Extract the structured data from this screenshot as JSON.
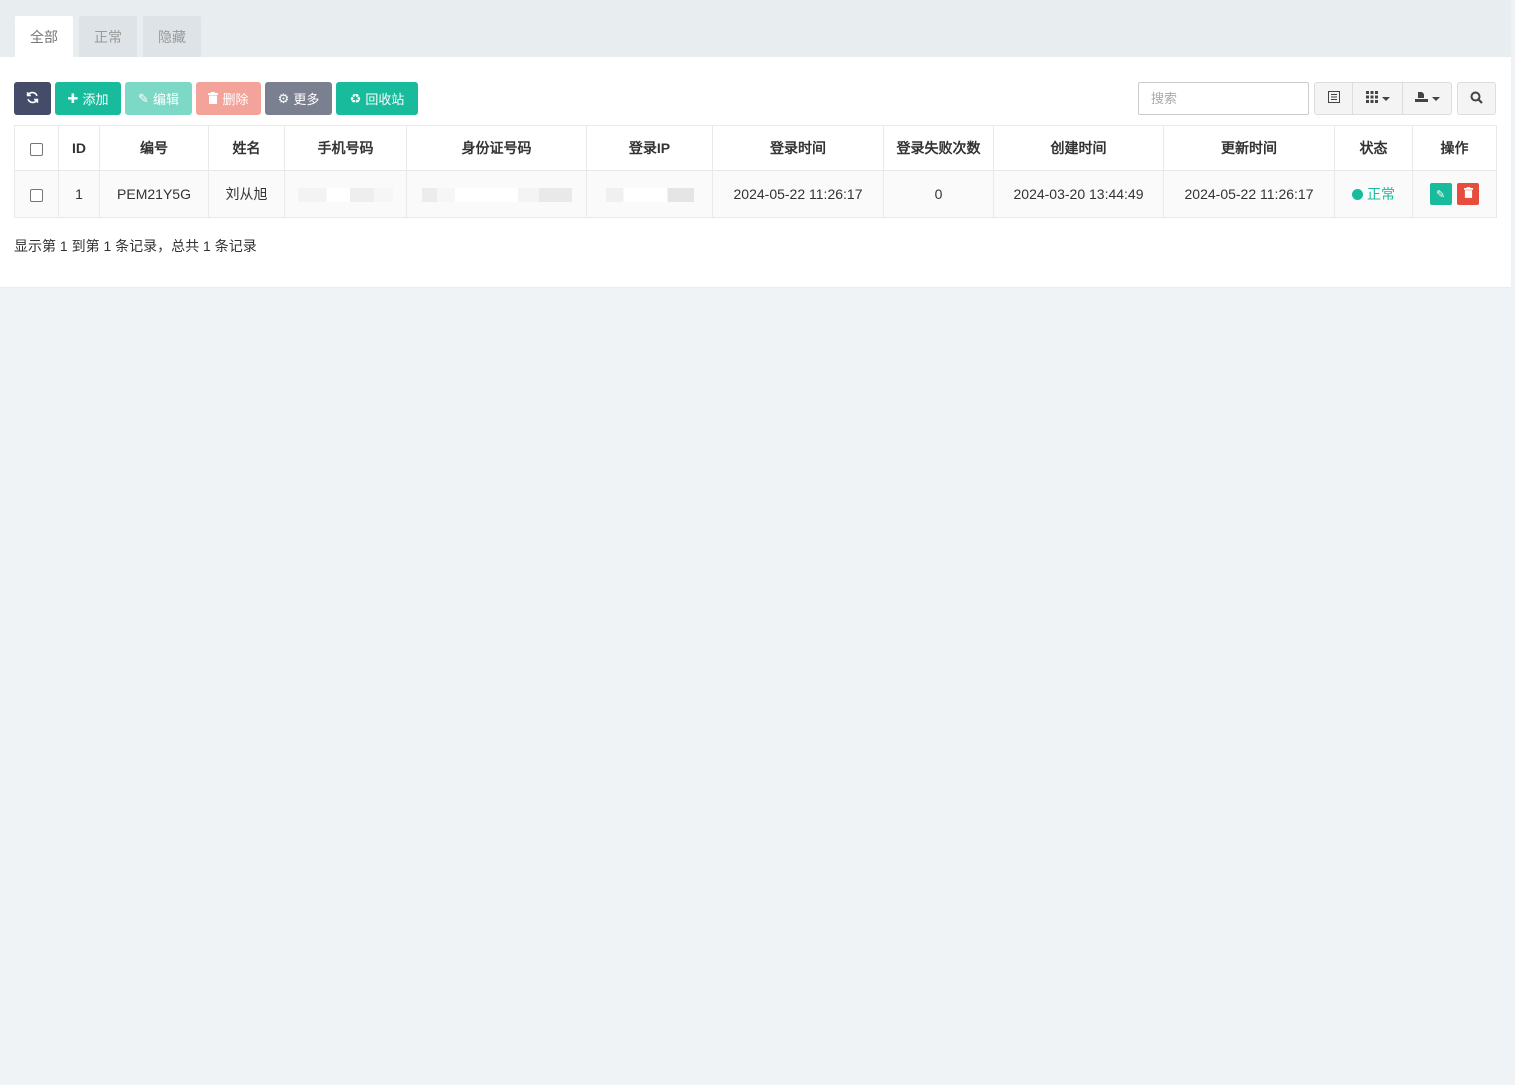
{
  "tabs": [
    {
      "label": "全部",
      "active": true
    },
    {
      "label": "正常",
      "active": false
    },
    {
      "label": "隐藏",
      "active": false
    }
  ],
  "toolbar": {
    "refresh_icon": "refresh-icon",
    "add_label": "添加",
    "edit_label": "编辑",
    "delete_label": "删除",
    "more_label": "更多",
    "recycle_label": "回收站"
  },
  "search": {
    "placeholder": "搜索",
    "value": ""
  },
  "tools": {
    "toggle_view_icon": "list-icon",
    "columns_icon": "grid-columns-icon",
    "export_icon": "export-icon",
    "search_icon": "search-icon"
  },
  "table": {
    "headers": {
      "id": "ID",
      "code": "编号",
      "name": "姓名",
      "phone": "手机号码",
      "idcard": "身份证号码",
      "login_ip": "登录IP",
      "login_time": "登录时间",
      "login_failures": "登录失败次数",
      "created": "创建时间",
      "updated": "更新时间",
      "status": "状态",
      "actions": "操作"
    },
    "rows": [
      {
        "id": "1",
        "code": "PEM21Y5G",
        "name": "刘从旭",
        "phone": "",
        "idcard": "",
        "login_ip": "",
        "login_time": "2024-05-22 11:26:17",
        "login_failures": "0",
        "created": "2024-03-20 13:44:49",
        "updated": "2024-05-22 11:26:17",
        "status": "正常"
      }
    ]
  },
  "pagination": {
    "summary": "显示第 1 到第 1 条记录，总共 1 条记录"
  },
  "colors": {
    "primary": "#18bc9c",
    "danger": "#e74c3c",
    "dark": "#444c69",
    "gray": "#7b8091"
  }
}
